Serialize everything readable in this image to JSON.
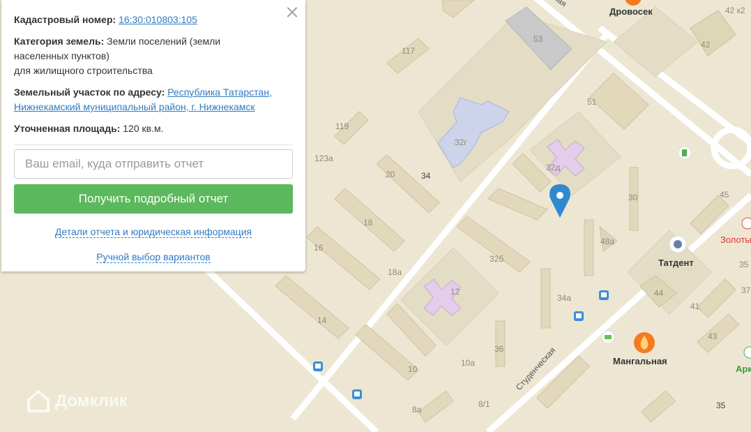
{
  "panel": {
    "cadastral_label": "Кадастровый номер:",
    "cadastral_value": "16:30:010803:105",
    "category_label": "Категория земель:",
    "category_value_1": "Земли поселений (земли",
    "category_value_2": "населенных пунктов)",
    "category_value_3": "для жилищного строительства",
    "address_label": "Земельный участок по адресу:",
    "address_value_1": "Республика Татарстан,",
    "address_value_2": "Нижнекамский муниципальный район, г. Нижнекамск",
    "area_label": "Уточненная площадь:",
    "area_value": "120 кв.м.",
    "email_placeholder": "Ваш email, куда отправить отчет",
    "get_report_button": "Получить подробный отчет",
    "details_link": "Детали отчета и юридическая информация",
    "manual_link": "Ручной выбор вариантов"
  },
  "map": {
    "places": {
      "drovosek": "Дровосек",
      "tatdent": "Татдент",
      "mangalnaya": "Мангальная",
      "zoloto": "Золоты",
      "ark": "Арк"
    },
    "street": "Студенческая",
    "house_numbers": {
      "h53": "53",
      "h42k2": "42 к2",
      "h42": "42",
      "h117": "117",
      "h51": "51",
      "h32g": "32г",
      "h119": "119",
      "h123a": "123а",
      "h32d": "32д",
      "h20": "20",
      "h34": "34",
      "h30": "30",
      "h45": "45",
      "h18": "18",
      "h48a": "48а",
      "h16": "16",
      "h32b": "32б",
      "h35a": "35",
      "h18a": "18а",
      "h12": "12",
      "h37": "37",
      "h44": "44",
      "h34a": "34а",
      "h41": "41",
      "h14": "14",
      "h43": "43",
      "h36": "36",
      "h10": "10",
      "h10a": "10а",
      "h8a": "8а",
      "h8_1": "8/1",
      "h35b": "35"
    },
    "logo": "Домклик"
  }
}
